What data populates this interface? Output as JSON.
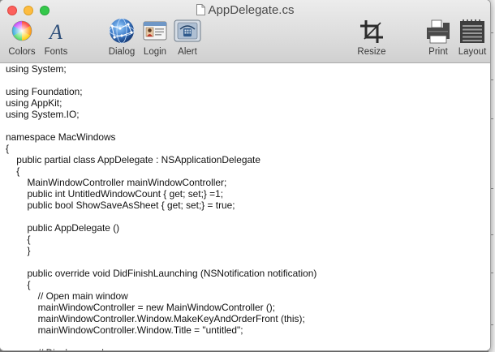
{
  "window": {
    "title": "AppDelegate.cs"
  },
  "toolbar": {
    "items": [
      {
        "id": "colors",
        "label": "Colors",
        "icon": "color-wheel-icon"
      },
      {
        "id": "fonts",
        "label": "Fonts",
        "icon": "font-italic-a-icon"
      },
      {
        "id": "dialog",
        "label": "Dialog",
        "icon": "globe-network-icon"
      },
      {
        "id": "login",
        "label": "Login",
        "icon": "id-card-icon"
      },
      {
        "id": "alert",
        "label": "Alert",
        "icon": "phone-device-icon"
      },
      {
        "id": "resize",
        "label": "Resize",
        "icon": "crop-icon"
      },
      {
        "id": "print",
        "label": "Print",
        "icon": "printer-icon"
      },
      {
        "id": "layout",
        "label": "Layout",
        "icon": "notepad-icon"
      }
    ]
  },
  "editor": {
    "lines": [
      "using System;",
      "",
      "using Foundation;",
      "using AppKit;",
      "using System.IO;",
      "",
      "namespace MacWindows",
      "{",
      "\tpublic partial class AppDelegate : NSApplicationDelegate",
      "\t{",
      "\t\tMainWindowController mainWindowController;",
      "\t\tpublic int UntitledWindowCount { get; set;} =1;",
      "\t\tpublic bool ShowSaveAsSheet { get; set;} = true;",
      "",
      "\t\tpublic AppDelegate ()",
      "\t\t{",
      "\t\t}",
      "",
      "\t\tpublic override void DidFinishLaunching (NSNotification notification)",
      "\t\t{",
      "\t\t\t// Open main window",
      "\t\t\tmainWindowController = new MainWindowController ();",
      "\t\t\tmainWindowController.Window.MakeKeyAndOrderFront (this);",
      "\t\t\tmainWindowController.Window.Title = \"untitled\";",
      "",
      "\t\t\t// Display panel"
    ]
  }
}
